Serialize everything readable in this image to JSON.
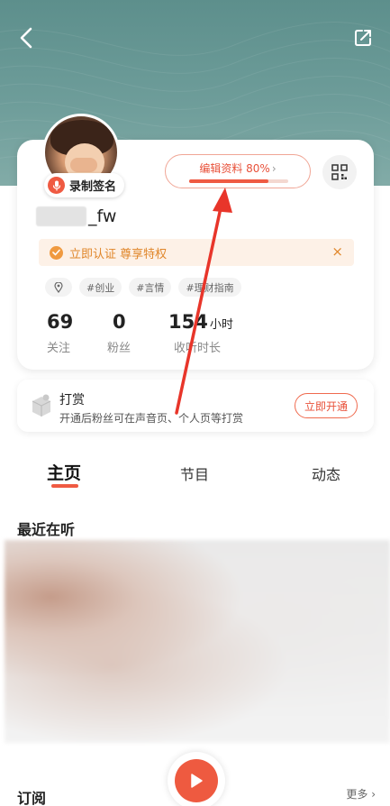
{
  "header": {
    "back_icon": "chevron-left-icon",
    "share_icon": "share-out-icon",
    "background_color": "#6a9996"
  },
  "profile": {
    "record_label": "录制签名",
    "edit_label": "编辑资料 80%",
    "edit_progress": 0.8,
    "username_suffix": "_fw",
    "verify_text": "立即认证 尊享特权",
    "verify_close": "×",
    "tags": [
      "#创业",
      "#言情",
      "#理财指南"
    ],
    "stats": [
      {
        "value": "69",
        "unit": "",
        "label": "关注"
      },
      {
        "value": "0",
        "unit": "",
        "label": "粉丝"
      },
      {
        "value": "154",
        "unit": "小时",
        "label": "收听时长"
      }
    ]
  },
  "reward": {
    "title": "打赏",
    "description": "开通后粉丝可在声音页、个人页等打赏",
    "button": "立即开通"
  },
  "tabs": [
    {
      "label": "主页",
      "active": true
    },
    {
      "label": "节目",
      "active": false
    },
    {
      "label": "动态",
      "active": false
    }
  ],
  "recent": {
    "title": "最近在听"
  },
  "subscribe": {
    "title": "订阅",
    "more": "更多",
    "more_chevron": "›"
  },
  "colors": {
    "accent": "#ef5a42",
    "verify": "#e0862a"
  }
}
